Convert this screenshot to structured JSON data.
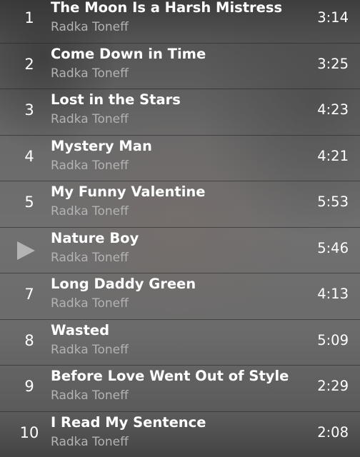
{
  "playlist": {
    "tracks": [
      {
        "number": "1",
        "title": "The Moon Is a Harsh Mistress",
        "artist": "Radka Toneff",
        "duration": "3:14",
        "playing": false
      },
      {
        "number": "2",
        "title": "Come Down in Time",
        "artist": "Radka Toneff",
        "duration": "3:25",
        "playing": false
      },
      {
        "number": "3",
        "title": "Lost in the Stars",
        "artist": "Radka Toneff",
        "duration": "4:23",
        "playing": false
      },
      {
        "number": "4",
        "title": "Mystery Man",
        "artist": "Radka Toneff",
        "duration": "4:21",
        "playing": false
      },
      {
        "number": "5",
        "title": "My Funny Valentine",
        "artist": "Radka Toneff",
        "duration": "5:53",
        "playing": false
      },
      {
        "number": "6",
        "title": "Nature Boy",
        "artist": "Radka Toneff",
        "duration": "5:46",
        "playing": true
      },
      {
        "number": "7",
        "title": "Long Daddy Green",
        "artist": "Radka Toneff",
        "duration": "4:13",
        "playing": false
      },
      {
        "number": "8",
        "title": "Wasted",
        "artist": "Radka Toneff",
        "duration": "5:09",
        "playing": false
      },
      {
        "number": "9",
        "title": "Before Love Went Out of Style",
        "artist": "Radka Toneff",
        "duration": "2:29",
        "playing": false
      },
      {
        "number": "10",
        "title": "I Read My Sentence",
        "artist": "Radka Toneff",
        "duration": "2:08",
        "playing": false
      }
    ]
  },
  "icons": {
    "now_playing": "play-triangle-icon"
  },
  "colors": {
    "title_text": "#ffffff",
    "artist_text": "#b3b3b3",
    "now_playing_icon": "#b4b4b4"
  }
}
